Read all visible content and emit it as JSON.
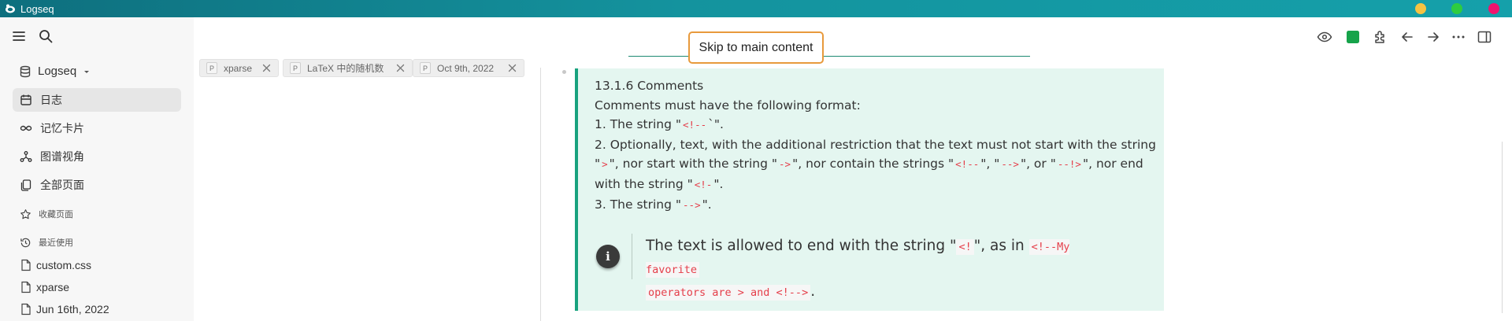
{
  "window": {
    "title": "Logseq",
    "controls": {
      "minimize_color": "#f5c342",
      "maximize_color": "#2ecc40",
      "close_color": "#f0146e"
    }
  },
  "sidebar": {
    "graph_name": "Logseq",
    "nav": [
      {
        "label": "日志",
        "icon": "calendar-icon",
        "active": true
      },
      {
        "label": "记忆卡片",
        "icon": "infinity-icon"
      },
      {
        "label": "图谱视角",
        "icon": "graph-icon"
      },
      {
        "label": "全部页面",
        "icon": "pages-icon"
      }
    ],
    "favorites_label": "收藏页面",
    "recent_label": "最近使用",
    "recent": [
      "custom.css",
      "xparse",
      "Jun 16th, 2022"
    ]
  },
  "header": {
    "skip_link": "Skip to main content",
    "toolbar_icons": [
      "eye-icon",
      "color-square-icon",
      "puzzle-icon",
      "arrow-left-icon",
      "arrow-right-icon",
      "more-icon",
      "right-sidebar-icon"
    ],
    "accent": "#18a27e"
  },
  "tabs": [
    {
      "prefix": "P",
      "label": "xparse"
    },
    {
      "prefix": "P",
      "label": "LaTeX 中的随机数"
    },
    {
      "prefix": "P",
      "label": "Oct 9th, 2022"
    }
  ],
  "content": {
    "heading": "13.1.6 Comments",
    "intro": "Comments must have the following format:",
    "item1": {
      "pre": "1. The string \"",
      "code": "<!--",
      "post": "`\"."
    },
    "item2": {
      "pre": "2. Optionally, text, with the additional restriction that the text must not start with the string \"",
      "c1": ">",
      "t1": "\", nor start with the string \"",
      "c2": "->",
      "t2": "\", nor contain the strings \"",
      "c3": "<!--",
      "t3": "\", \"",
      "c4": "-->",
      "t4": "\", or \"",
      "c5": "--!>",
      "t5": "\", nor end with the string \"",
      "c6": "<!-",
      "t6": "\"."
    },
    "item3": {
      "pre": "3. The string \"",
      "code": "-->",
      "post": "\"."
    },
    "callout": {
      "pre": "The text is allowed to end with the string \"",
      "c1": "<!",
      "t1": "\", as in ",
      "c2a": "<!--My favorite",
      "c2b": "operators are > and <!-->",
      "t2": "."
    }
  }
}
